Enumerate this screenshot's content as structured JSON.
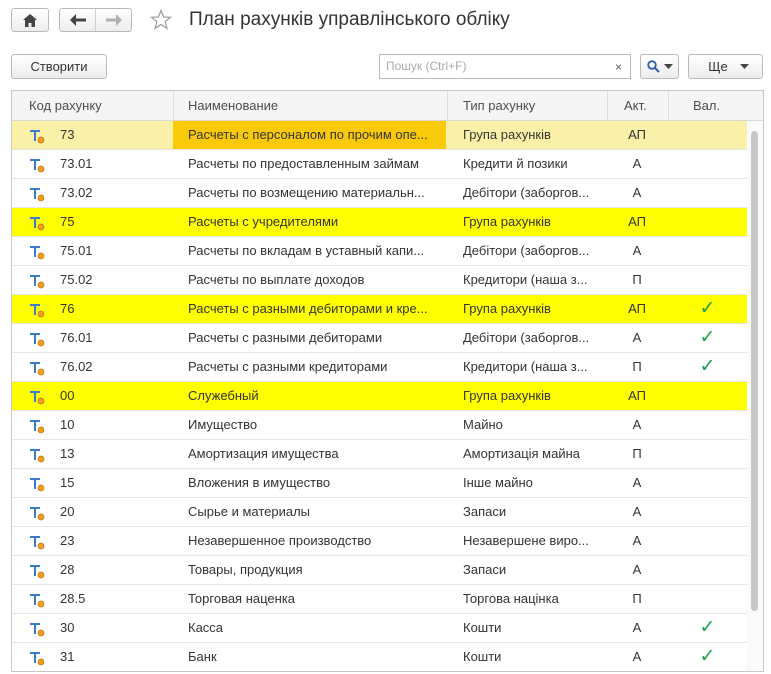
{
  "window": {
    "title": "План рахунків управлінського обліку"
  },
  "toolbar": {
    "create_label": "Створити",
    "search_placeholder": "Пошук (Ctrl+F)",
    "clear_label": "×",
    "more_label": "Ще"
  },
  "table": {
    "headers": {
      "code": "Код рахунку",
      "name": "Наименование",
      "type": "Тип рахунку",
      "kind": "Акт.",
      "currency": "Вал."
    },
    "rows": [
      {
        "code": "73",
        "name": "Расчеты с персоналом по прочим опе...",
        "type": "Група рахунків",
        "kind": "АП",
        "currency": "",
        "group": true,
        "selected": true
      },
      {
        "code": "73.01",
        "name": "Расчеты по предоставленным займам",
        "type": "Кредити й позики",
        "kind": "А",
        "currency": ""
      },
      {
        "code": "73.02",
        "name": "Расчеты по возмещению материальн...",
        "type": "Дебітори (заборгов...",
        "kind": "А",
        "currency": ""
      },
      {
        "code": "75",
        "name": "Расчеты с учредителями",
        "type": "Група рахунків",
        "kind": "АП",
        "currency": "",
        "group": true
      },
      {
        "code": "75.01",
        "name": "Расчеты по вкладам в уставный капи...",
        "type": "Дебітори (заборгов...",
        "kind": "А",
        "currency": ""
      },
      {
        "code": "75.02",
        "name": "Расчеты по выплате доходов",
        "type": "Кредитори (наша з...",
        "kind": "П",
        "currency": ""
      },
      {
        "code": "76",
        "name": "Расчеты с разными дебиторами и кре...",
        "type": "Група рахунків",
        "kind": "АП",
        "currency": "✓",
        "group": true
      },
      {
        "code": "76.01",
        "name": "Расчеты с разными дебиторами",
        "type": "Дебітори (заборгов...",
        "kind": "А",
        "currency": "✓"
      },
      {
        "code": "76.02",
        "name": "Расчеты с разными кредиторами",
        "type": "Кредитори (наша з...",
        "kind": "П",
        "currency": "✓"
      },
      {
        "code": "00",
        "name": "Служебный",
        "type": "Група рахунків",
        "kind": "АП",
        "currency": "",
        "group": true
      },
      {
        "code": "10",
        "name": "Имущество",
        "type": "Майно",
        "kind": "А",
        "currency": ""
      },
      {
        "code": "13",
        "name": "Амортизация имущества",
        "type": "Амортизація майна",
        "kind": "П",
        "currency": ""
      },
      {
        "code": "15",
        "name": "Вложения в имущество",
        "type": "Інше майно",
        "kind": "А",
        "currency": ""
      },
      {
        "code": "20",
        "name": "Сырье и материалы",
        "type": "Запаси",
        "kind": "А",
        "currency": ""
      },
      {
        "code": "23",
        "name": "Незавершенное производство",
        "type": "Незавершене виро...",
        "kind": "А",
        "currency": ""
      },
      {
        "code": "28",
        "name": "Товары, продукция",
        "type": "Запаси",
        "kind": "А",
        "currency": ""
      },
      {
        "code": "28.5",
        "name": "Торговая наценка",
        "type": "Торгова націнка",
        "kind": "П",
        "currency": ""
      },
      {
        "code": "30",
        "name": "Касса",
        "type": "Кошти",
        "kind": "А",
        "currency": "✓"
      },
      {
        "code": "31",
        "name": "Банк",
        "type": "Кошти",
        "kind": "А",
        "currency": "✓"
      }
    ]
  },
  "colors": {
    "group_row": "#ffff00",
    "selected_row": "#fbf0a8",
    "selected_cell": "#f9c90a",
    "checkmark": "#1aa14a"
  },
  "icons": {
    "home": "home-icon",
    "back": "arrow-left-icon",
    "forward": "arrow-right-icon",
    "favorite": "star-icon",
    "search": "magnifier-icon",
    "dropdown": "chevron-down-icon",
    "account": "account-type-icon"
  }
}
